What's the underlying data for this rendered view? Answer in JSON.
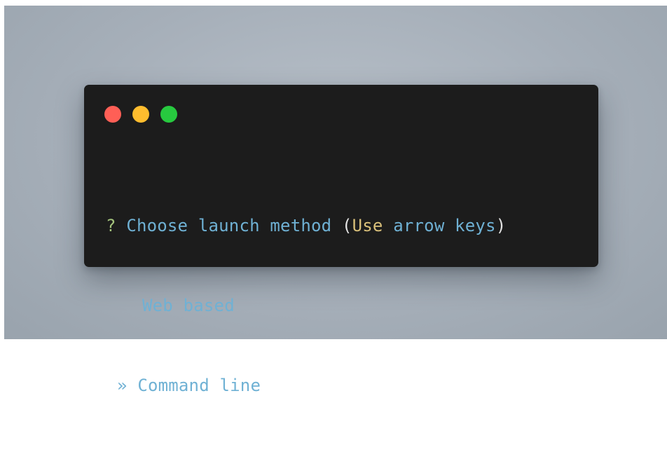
{
  "window": {
    "controls": [
      "close-icon",
      "minimize-icon",
      "maximize-icon"
    ],
    "colors": {
      "close": "#ff5f56",
      "minimize": "#ffbd2e",
      "maximize": "#27c93f"
    }
  },
  "prompt": {
    "question_mark": "?",
    "question": "Choose launch method",
    "hint_open": "(",
    "hint_use": "Use",
    "hint_rest": "arrow keys",
    "hint_close": ")"
  },
  "options": [
    {
      "label": "Web based",
      "selected": false
    },
    {
      "label": "Command line",
      "selected": true
    }
  ],
  "pointer": "»"
}
